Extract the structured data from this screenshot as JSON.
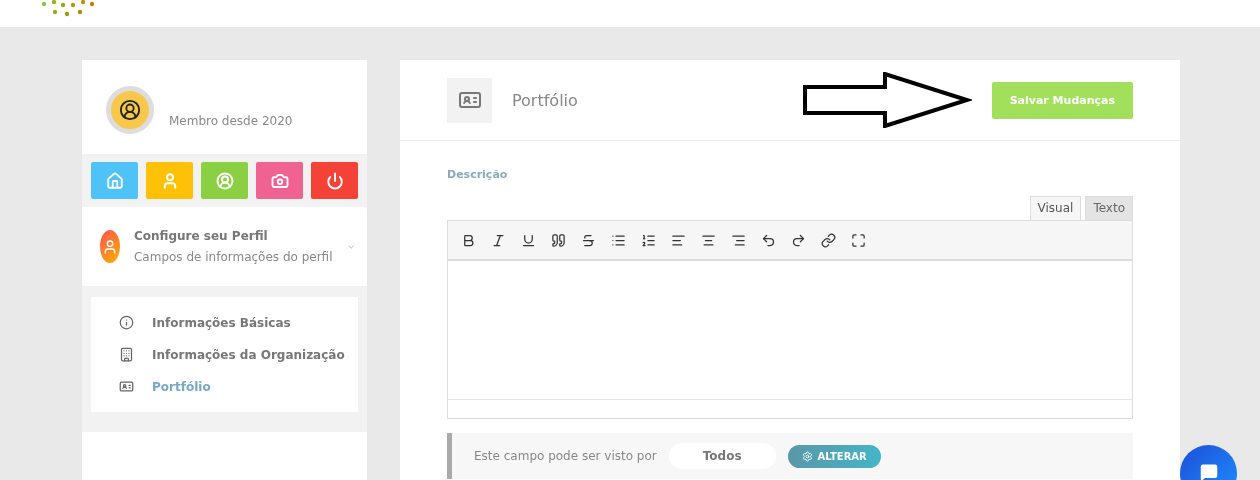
{
  "profile": {
    "since": "Membro desde 2020"
  },
  "quick_buttons": [
    {
      "color": "#4fc3f7"
    },
    {
      "color": "#ffc107"
    },
    {
      "color": "#8bd043"
    },
    {
      "color": "#f06292"
    },
    {
      "color": "#f44336"
    }
  ],
  "profile_section": {
    "title": "Configure seu Perfil",
    "subtitle": "Campos de informações do perfil"
  },
  "nav_items": [
    {
      "label": "Informações Básicas",
      "selected": false
    },
    {
      "label": "Informações da Organização",
      "selected": false
    },
    {
      "label": "Portfólio",
      "selected": true
    }
  ],
  "header": {
    "title": "Portfólio",
    "save_button": "Salvar Mudanças"
  },
  "description": {
    "label": "Descrição",
    "tabs": [
      {
        "label": "Visual",
        "selected": true
      },
      {
        "label": "Texto",
        "selected": false
      }
    ]
  },
  "visibility": {
    "text": "Este campo pode ser visto por",
    "value": "Todos",
    "button": "ALTERAR"
  }
}
